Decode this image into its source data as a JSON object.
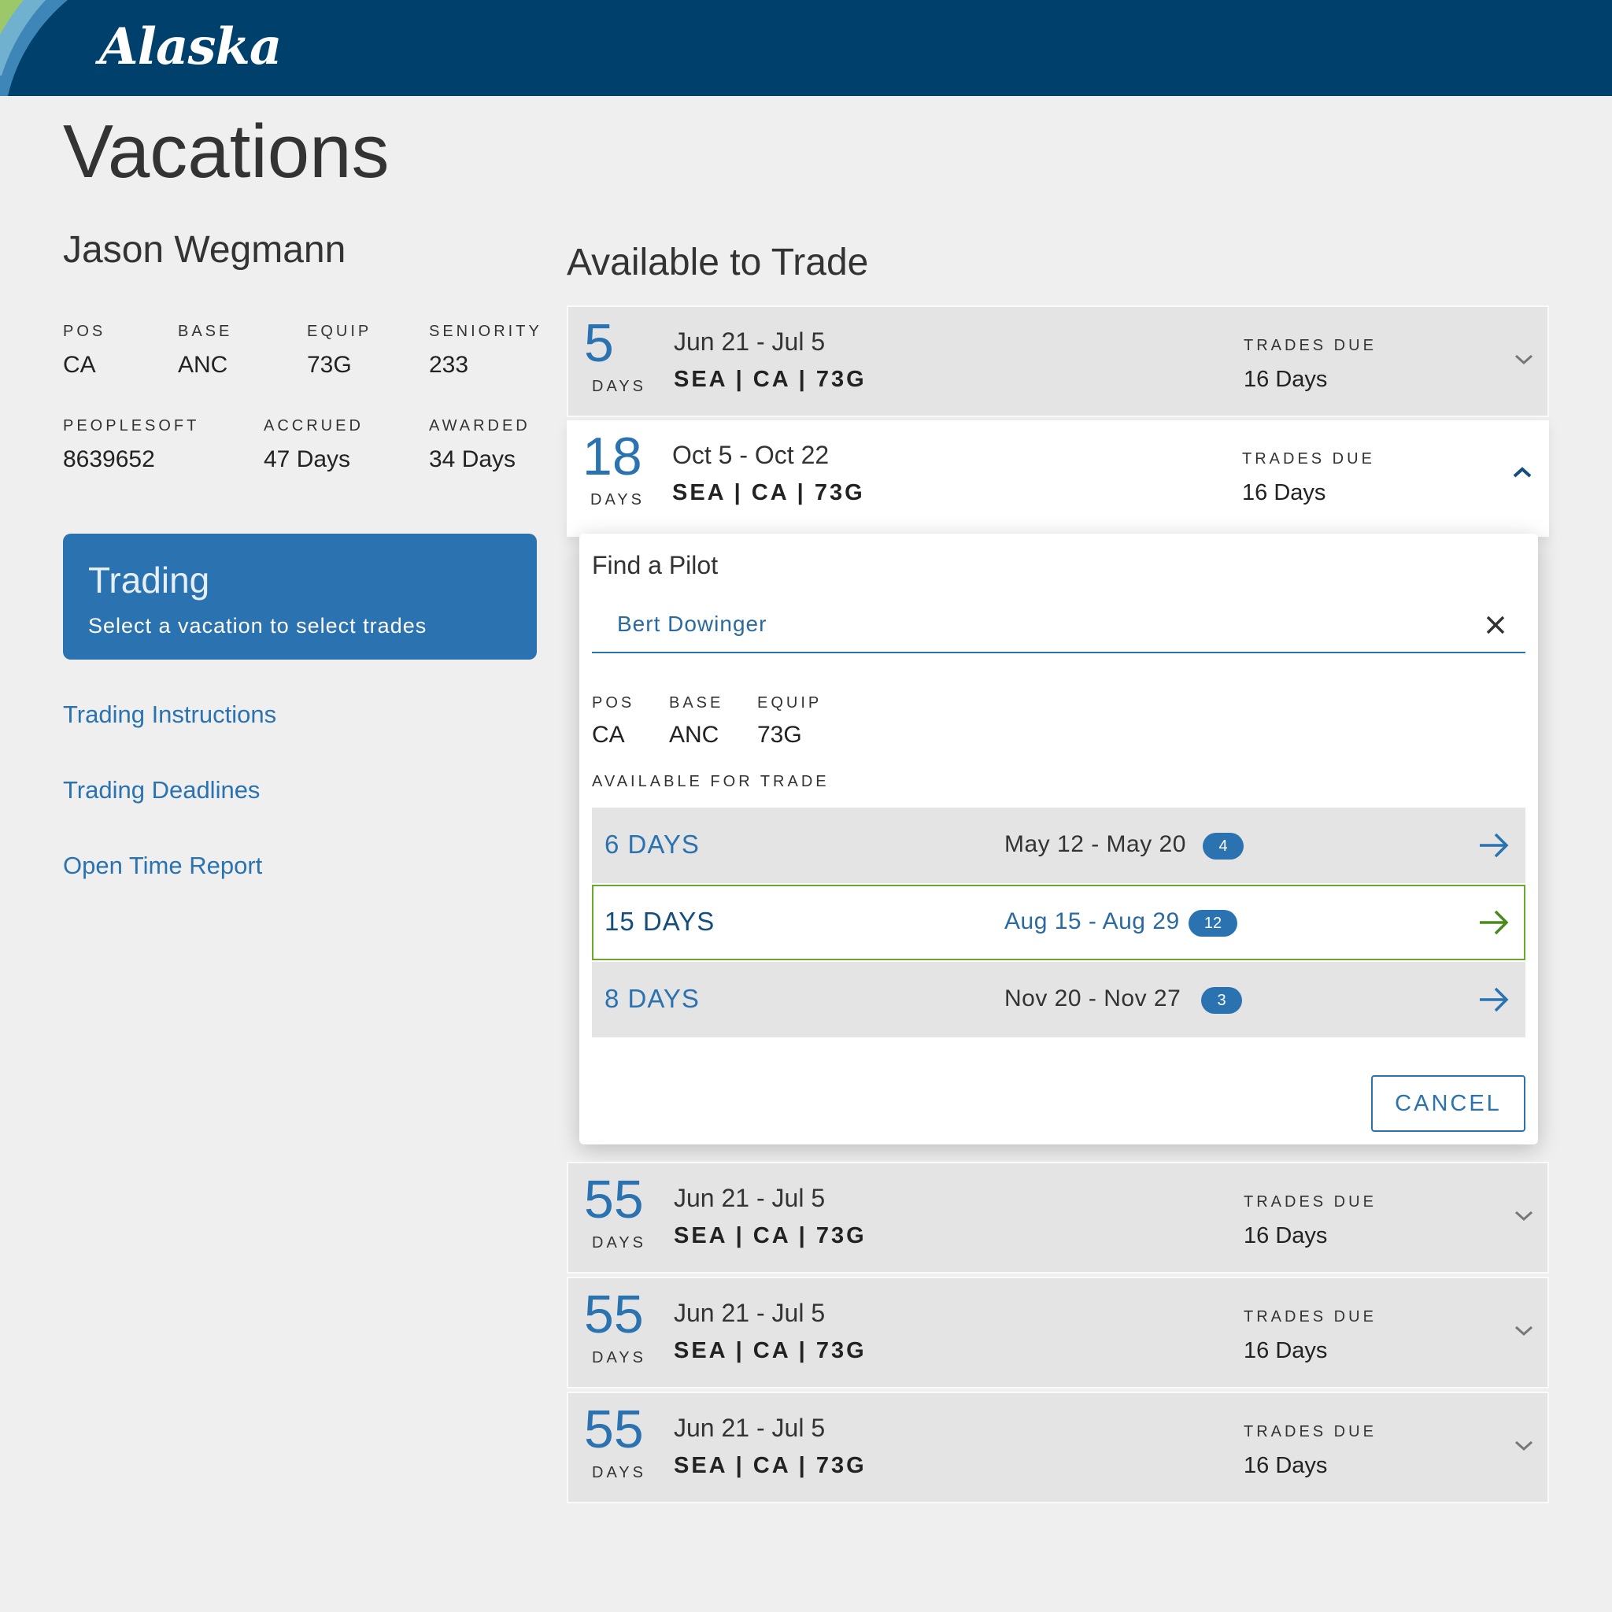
{
  "header": {
    "logo_text": "Alaska"
  },
  "page_title": "Vacations",
  "pilot": {
    "name": "Jason Wegmann",
    "stats": [
      {
        "label": "POS",
        "value": "CA"
      },
      {
        "label": "BASE",
        "value": "ANC"
      },
      {
        "label": "EQUIP",
        "value": "73G"
      },
      {
        "label": "SENIORITY",
        "value": "233"
      },
      {
        "label": "PEOPLESOFT",
        "value": "8639652"
      },
      {
        "label": "ACCRUED",
        "value": "47 Days"
      },
      {
        "label": "AWARDED",
        "value": "34 Days"
      }
    ]
  },
  "trading_card": {
    "title": "Trading",
    "subtitle": "Select a vacation to select trades"
  },
  "links": [
    "Trading Instructions",
    "Trading Deadlines",
    "Open Time Report"
  ],
  "available": {
    "title": "Available to Trade",
    "days_label": "DAYS",
    "trades_due_label": "TRADES DUE",
    "items": [
      {
        "days": "5",
        "dates": "Jun 21 - Jul 5",
        "route": "SEA | CA | 73G",
        "trades_due": "16 Days",
        "expanded": false
      },
      {
        "days": "18",
        "dates": "Oct 5 - Oct 22",
        "route": "SEA | CA | 73G",
        "trades_due": "16 Days",
        "expanded": true
      },
      {
        "days": "55",
        "dates": "Jun 21 - Jul 5",
        "route": "SEA | CA | 73G",
        "trades_due": "16 Days",
        "expanded": false
      },
      {
        "days": "55",
        "dates": "Jun 21 - Jul 5",
        "route": "SEA | CA | 73G",
        "trades_due": "16 Days",
        "expanded": false
      },
      {
        "days": "55",
        "dates": "Jun 21 - Jul 5",
        "route": "SEA | CA | 73G",
        "trades_due": "16 Days",
        "expanded": false
      }
    ]
  },
  "find_pilot": {
    "title": "Find a Pilot",
    "search_value": "Bert Dowinger",
    "stats": [
      {
        "label": "POS",
        "value": "CA"
      },
      {
        "label": "BASE",
        "value": "ANC"
      },
      {
        "label": "EQUIP",
        "value": "73G"
      }
    ],
    "available_label": "AVAILABLE FOR TRADE",
    "trades": [
      {
        "days": "6 DAYS",
        "range": "May 12 - May 20",
        "count": "4",
        "selected": false
      },
      {
        "days": "15 DAYS",
        "range": "Aug 15 - Aug 29",
        "count": "12",
        "selected": true
      },
      {
        "days": "8 DAYS",
        "range": "Nov 20 - Nov 27",
        "count": "3",
        "selected": false
      }
    ],
    "cancel_label": "CANCEL"
  },
  "colors": {
    "header": "#00406c",
    "accent": "#2a72b0",
    "selected_border": "#6aa92e",
    "selected_arrow": "#4a8a1c"
  }
}
